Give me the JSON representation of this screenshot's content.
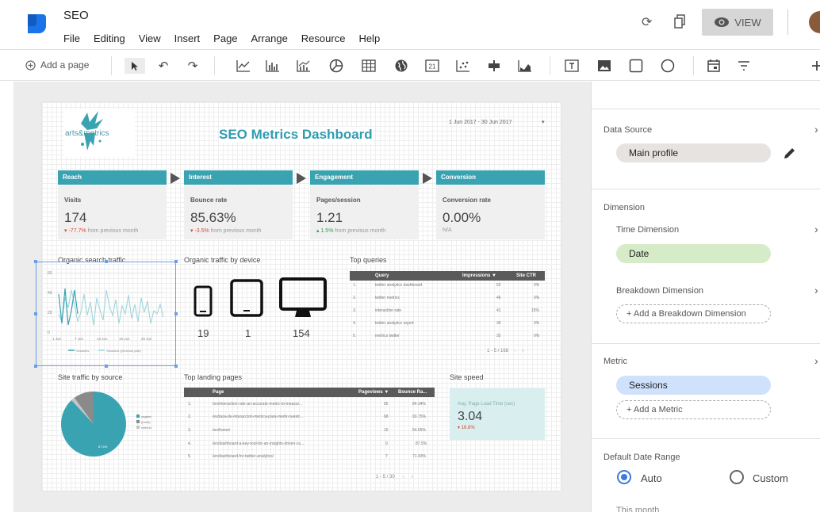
{
  "header": {
    "title": "SEO",
    "menu": [
      "File",
      "Editing",
      "View",
      "Insert",
      "Page",
      "Arrange",
      "Resource",
      "Help"
    ],
    "view_label": "VIEW"
  },
  "toolbar": {
    "add_page_label": "Add a page"
  },
  "report": {
    "brand": "arts&metrics",
    "title": "SEO Metrics Dashboard",
    "date_range": "1 Jun 2017 - 30 Jun 2017",
    "funnel": [
      {
        "stage": "Reach",
        "metric": "Visits",
        "value": "174",
        "delta": "-77.7%",
        "delta_text": "from previous month",
        "dir": "neg"
      },
      {
        "stage": "Interest",
        "metric": "Bounce rate",
        "value": "85.63%",
        "delta": "-3.5%",
        "delta_text": "from previous month",
        "dir": "neg"
      },
      {
        "stage": "Engagement",
        "metric": "Pages/session",
        "value": "1.21",
        "delta": "1.5%",
        "delta_text": "from previous month",
        "dir": "pos"
      },
      {
        "stage": "Conversion",
        "metric": "Conversion rate",
        "value": "0.00%",
        "delta": "N/A",
        "delta_text": "",
        "dir": "none"
      }
    ],
    "organic_search": {
      "title": "Organic search traffic",
      "y_ticks": [
        "60",
        "40",
        "20",
        "0"
      ],
      "x_ticks": [
        "1 Jun",
        "7 Jun",
        "13 Jun",
        "19 Jun",
        "25 Jun"
      ],
      "legend": [
        "Sessions",
        "Sessions (previous year)"
      ]
    },
    "device": {
      "title": "Organic traffic by device",
      "counts": [
        "19",
        "1",
        "154"
      ]
    },
    "top_queries": {
      "title": "Top queries",
      "headers": [
        "Query",
        "Impressions ▼",
        "Site CTR"
      ],
      "rows": [
        [
          "1.",
          "twitter analytics dashboard",
          "62",
          "0%"
        ],
        [
          "2.",
          "twitter metrics",
          "46",
          "0%"
        ],
        [
          "3.",
          "interaction rate",
          "41",
          "15%"
        ],
        [
          "4.",
          "twitter analytics report",
          "34",
          "0%"
        ],
        [
          "5.",
          "metrics twitter",
          "32",
          "0%"
        ]
      ],
      "pager": "1 - 5 / 168"
    },
    "site_traffic": {
      "title": "Site traffic by source",
      "legend": [
        "organic",
        "(none)",
        "referral"
      ],
      "slice_label": "87.5%"
    },
    "landing_pages": {
      "title": "Top landing pages",
      "headers": [
        "Page",
        "Pageviews ▼",
        "Bounce Ra..."
      ],
      "rows": [
        [
          "1.",
          "/en/interaction-rate-an-accurate-metric-to-measur...",
          "95",
          "84.34%"
        ],
        [
          "2.",
          "/es/tasa-de-interaccion-metrica-para-medir-nuestr...",
          "68",
          "93.75%"
        ],
        [
          "3.",
          "/en/home/",
          "15",
          "54.55%"
        ],
        [
          "4.",
          "/en/dashboard-a-key-tool-for-an-insights-driven-cu...",
          "9",
          "87.5%"
        ],
        [
          "5.",
          "/en/dashboard-for-twitter-analytics/",
          "7",
          "71.43%"
        ]
      ],
      "pager": "1 - 5 / 30"
    },
    "site_speed": {
      "title": "Site speed",
      "metric": "Avg. Page Load Time (sec)",
      "value": "3.04",
      "delta": "16.8%"
    }
  },
  "panel": {
    "data_source_label": "Data Source",
    "data_source_value": "Main profile",
    "dimension_label": "Dimension",
    "time_dimension_label": "Time Dimension",
    "time_dimension_value": "Date",
    "breakdown_label": "Breakdown Dimension",
    "breakdown_add": "+ Add a Breakdown Dimension",
    "metric_label": "Metric",
    "metric_value": "Sessions",
    "metric_add": "+ Add a Metric",
    "date_range_label": "Default Date Range",
    "auto_label": "Auto",
    "custom_label": "Custom",
    "this_month": "This month"
  },
  "colors": {
    "accent": "#3aa3b1",
    "chip_grey": "#e6e3e0",
    "chip_green": "#d6ecc9",
    "chip_blue": "#cfe1fb",
    "radio": "#3a7be0"
  }
}
